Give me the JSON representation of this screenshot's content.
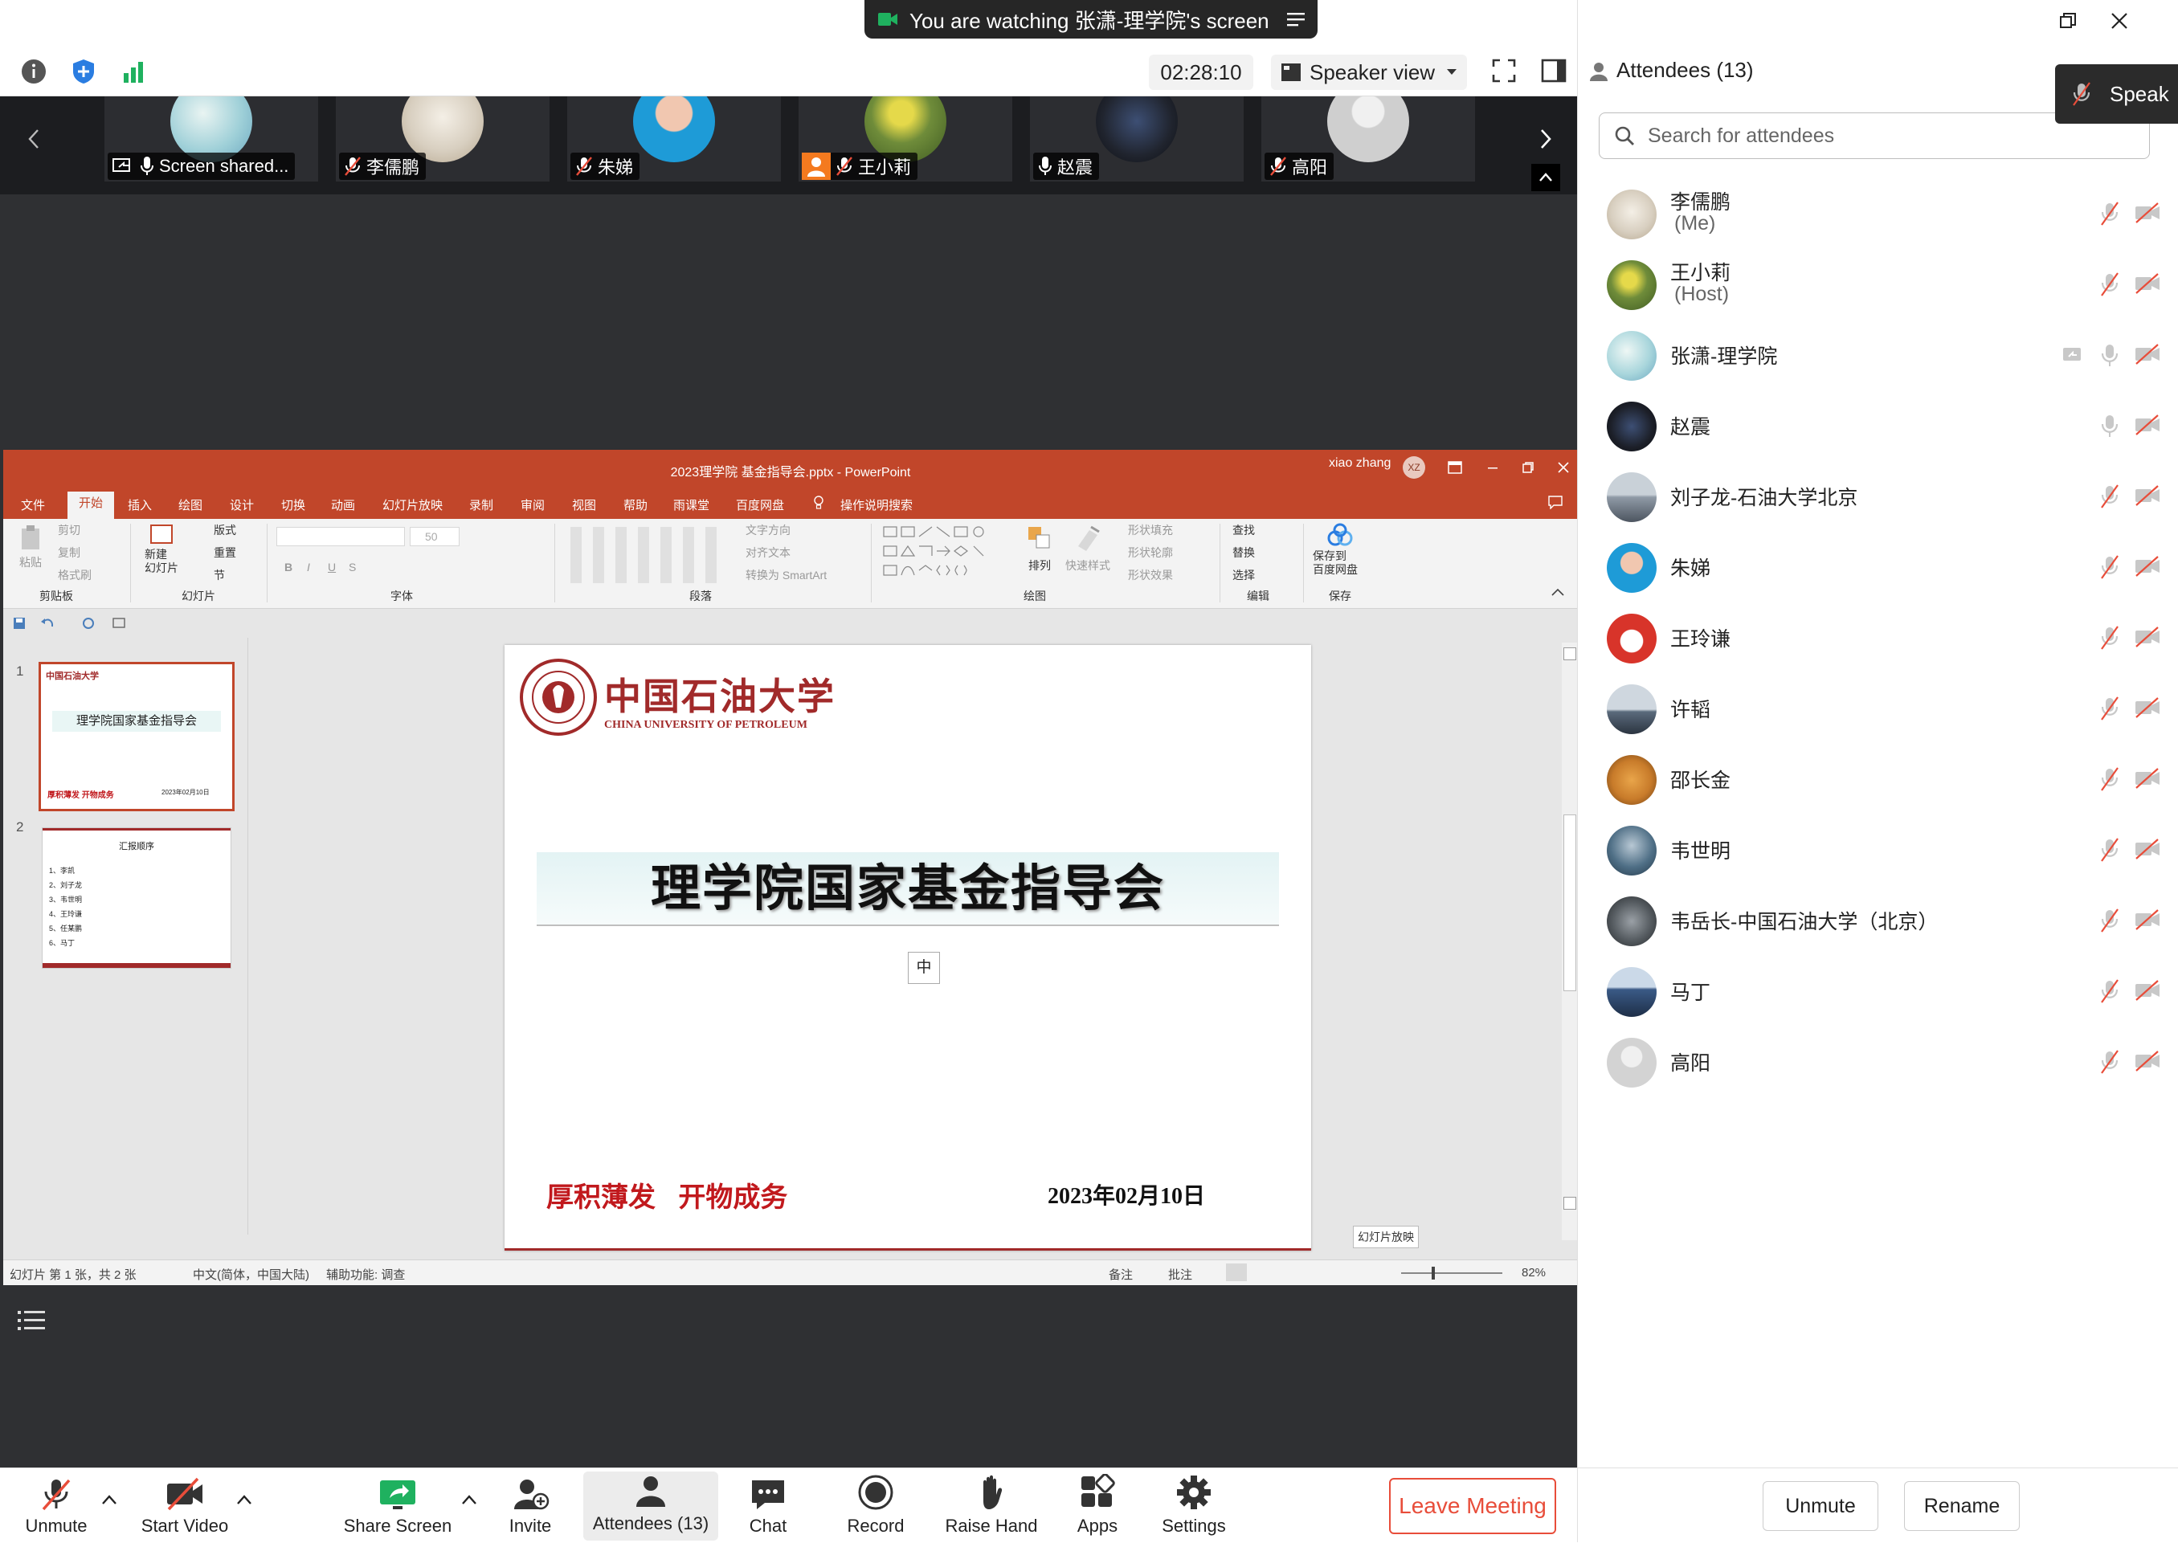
{
  "window": {
    "share_banner": "You are watching 张潇-理学院's screen"
  },
  "top_toolbar": {
    "timer": "02:28:10",
    "view_label": "Speaker view"
  },
  "thumbnails": [
    {
      "name": "Screen shared...",
      "avatar_color": "#9fd0d8"
    },
    {
      "name": "李儒鹏",
      "avatar_color": "#d8cfc0"
    },
    {
      "name": "朱娣",
      "avatar_color": "#1e9bd7"
    },
    {
      "name": "王小莉",
      "avatar_color": "#6f8c3a"
    },
    {
      "name": "赵震",
      "avatar_color": "#20242e"
    },
    {
      "name": "高阳",
      "avatar_color": "#cfcfcf"
    }
  ],
  "ppt": {
    "title": "2023理学院 基金指导会.pptx - PowerPoint",
    "user": "xiao zhang",
    "user_initials": "XZ",
    "tabs": [
      "文件",
      "开始",
      "插入",
      "绘图",
      "设计",
      "切换",
      "动画",
      "幻灯片放映",
      "录制",
      "审阅",
      "视图",
      "帮助",
      "雨课堂",
      "百度网盘",
      "操作说明搜索"
    ],
    "ribbon_groups": [
      "剪贴板",
      "幻灯片",
      "字体",
      "段落",
      "绘图",
      "编辑",
      "保存"
    ],
    "ribbon_buttons": {
      "paste": "粘贴",
      "cut": "剪切",
      "copy": "复制",
      "format_painter": "格式刷",
      "new_slide": "新建\n幻灯片",
      "layout": "版式",
      "reset": "重置",
      "section": "节",
      "text_direction": "文字方向",
      "align_text": "对齐文本",
      "smartart": "转换为 SmartArt",
      "arrange": "排列",
      "quick_styles": "快速样式",
      "shape_fill": "形状填充",
      "shape_outline": "形状轮廓",
      "shape_effects": "形状效果",
      "find": "查找",
      "replace": "替换",
      "select": "选择",
      "save_baidu": "保存到\n百度网盘",
      "font_size": "50"
    },
    "slide1_thumb": {
      "logo": "中国石油大学",
      "title": "理学院国家基金指导会",
      "slogan": "厚积薄发 开物成务",
      "date": "2023年02月10日"
    },
    "slide2_thumb": {
      "title": "汇报顺序",
      "items": [
        "1、李凯",
        "2、刘子龙",
        "3、韦世明",
        "4、王玲谦",
        "5、任某鹏",
        "6、马丁"
      ]
    },
    "main_slide": {
      "logo_cn": "中国石油大学",
      "logo_en": "CHINA UNIVERSITY OF PETROLEUM",
      "title": "理学院国家基金指导会",
      "ime_badge": "中",
      "slogan_a": "厚积薄发",
      "slogan_b": "开物成务",
      "date": "2023年02月10日"
    },
    "tooltip": "幻灯片放映",
    "status": {
      "slide_info": "幻灯片 第 1 张，共 2 张",
      "language": "中文(简体，中国大陆)",
      "accessibility": "辅助功能: 调查",
      "notes": "备注",
      "comments": "批注",
      "zoom": "82%"
    }
  },
  "bottom_toolbar": {
    "unmute": "Unmute",
    "start_video": "Start Video",
    "share_screen": "Share Screen",
    "invite": "Invite",
    "attendees": "Attendees (13)",
    "chat": "Chat",
    "record": "Record",
    "raise_hand": "Raise Hand",
    "apps": "Apps",
    "settings": "Settings",
    "leave": "Leave Meeting",
    "accent_green": "#1fb15f",
    "leave_color": "#e84d3a"
  },
  "panel": {
    "title": "Attendees (13)",
    "search_placeholder": "Search for attendees",
    "speak_popup": "Speak",
    "attendees": [
      {
        "name": "李儒鹏",
        "role": "(Me)",
        "avatar_color": "#d8cfc0"
      },
      {
        "name": "王小莉",
        "role": "(Host)",
        "avatar_color": "#6f8c3a"
      },
      {
        "name": "张潇-理学院",
        "role": "",
        "avatar_color": "#a9d6dc"
      },
      {
        "name": "赵震",
        "role": "",
        "avatar_color": "#1c1f28"
      },
      {
        "name": "刘子龙-石油大学北京",
        "role": "",
        "avatar_color": "#8f9aa6"
      },
      {
        "name": "朱娣",
        "role": "",
        "avatar_color": "#1e9bd7"
      },
      {
        "name": "王玲谦",
        "role": "",
        "avatar_color": "#d8342a"
      },
      {
        "name": "许韬",
        "role": "",
        "avatar_color": "#5b6b7c"
      },
      {
        "name": "邵长金",
        "role": "",
        "avatar_color": "#c87b2a"
      },
      {
        "name": "韦世明",
        "role": "",
        "avatar_color": "#4f6f86"
      },
      {
        "name": "韦岳长-中国石油大学（北京）",
        "role": "",
        "avatar_color": "#555b60"
      },
      {
        "name": "马丁",
        "role": "",
        "avatar_color": "#3a5a86"
      },
      {
        "name": "高阳",
        "role": "",
        "avatar_color": "#d3d3d3"
      }
    ],
    "unmute_btn": "Unmute",
    "rename_btn": "Rename"
  }
}
